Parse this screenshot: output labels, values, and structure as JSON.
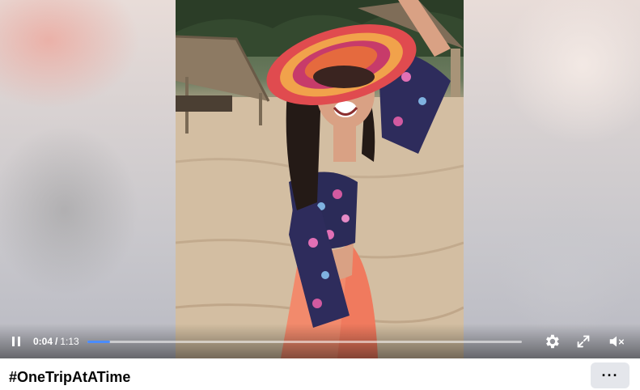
{
  "video": {
    "current_time": "0:04",
    "time_separator": "/",
    "duration": "1:13",
    "progress_fraction": 0.052,
    "state": "playing",
    "muted": true,
    "accent_color": "#4a8cff"
  },
  "controls": {
    "pause_icon": "pause-icon",
    "settings_icon": "gear-icon",
    "fullscreen_icon": "expand-icon",
    "mute_icon": "speaker-muted-icon"
  },
  "post": {
    "title": "#OneTripAtATime",
    "more_label": "···"
  }
}
